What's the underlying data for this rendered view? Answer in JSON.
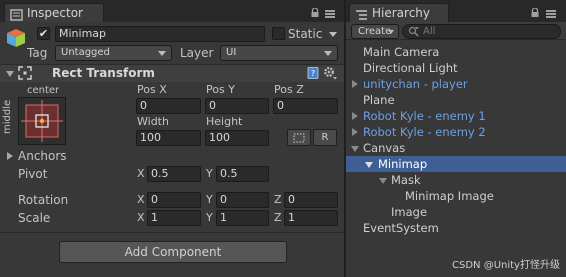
{
  "inspector": {
    "tab_label": "Inspector",
    "object_active": true,
    "object_name": "Minimap",
    "static_label": "Static",
    "tag_label": "Tag",
    "tag_value": "Untagged",
    "layer_label": "Layer",
    "layer_value": "UI",
    "component": {
      "title": "Rect Transform",
      "anchor_preset_top": "center",
      "anchor_preset_side": "middle",
      "pos_x_label": "Pos X",
      "pos_y_label": "Pos Y",
      "pos_z_label": "Pos Z",
      "pos_x": "0",
      "pos_y": "0",
      "pos_z": "0",
      "width_label": "Width",
      "height_label": "Height",
      "width": "100",
      "height": "100",
      "raw_edit_label": "R",
      "anchors_label": "Anchors",
      "pivot_label": "Pivot",
      "pivot_x_label": "X",
      "pivot_x": "0.5",
      "pivot_y_label": "Y",
      "pivot_y": "0.5",
      "rotation_label": "Rotation",
      "rotation_x_label": "X",
      "rotation_x": "0",
      "rotation_y_label": "Y",
      "rotation_y": "0",
      "rotation_z_label": "Z",
      "rotation_z": "0",
      "scale_label": "Scale",
      "scale_x_label": "X",
      "scale_x": "1",
      "scale_y_label": "Y",
      "scale_y": "1",
      "scale_z_label": "Z",
      "scale_z": "1"
    },
    "add_component_label": "Add Component"
  },
  "hierarchy": {
    "tab_label": "Hierarchy",
    "create_label": "Create",
    "search_placeholder": "All",
    "items": [
      {
        "label": "Main Camera",
        "prefab": false
      },
      {
        "label": "Directional Light",
        "prefab": false
      },
      {
        "label": "unitychan - player",
        "prefab": true
      },
      {
        "label": "Plane",
        "prefab": false
      },
      {
        "label": "Robot Kyle - enemy 1",
        "prefab": true
      },
      {
        "label": "Robot Kyle - enemy 2",
        "prefab": true
      },
      {
        "label": "Canvas",
        "prefab": false
      },
      {
        "label": "Minimap",
        "prefab": false,
        "selected": true
      },
      {
        "label": "Mask",
        "prefab": false
      },
      {
        "label": "Minimap Image",
        "prefab": false
      },
      {
        "label": "Image",
        "prefab": false
      },
      {
        "label": "EventSystem",
        "prefab": false
      }
    ]
  },
  "watermark": "CSDN @Unity打怪升级",
  "colors": {
    "panel_bg": "#383838",
    "selection": "#3e5f96",
    "prefab_text": "#6b9fe8"
  },
  "icons": {
    "inspector_tab": "inspector-icon",
    "hierarchy_tab": "hierarchy-icon",
    "object": "gameobject-cube-icon",
    "component": "rect-transform-icon",
    "help": "help-book-icon",
    "settings": "gear-icon"
  }
}
